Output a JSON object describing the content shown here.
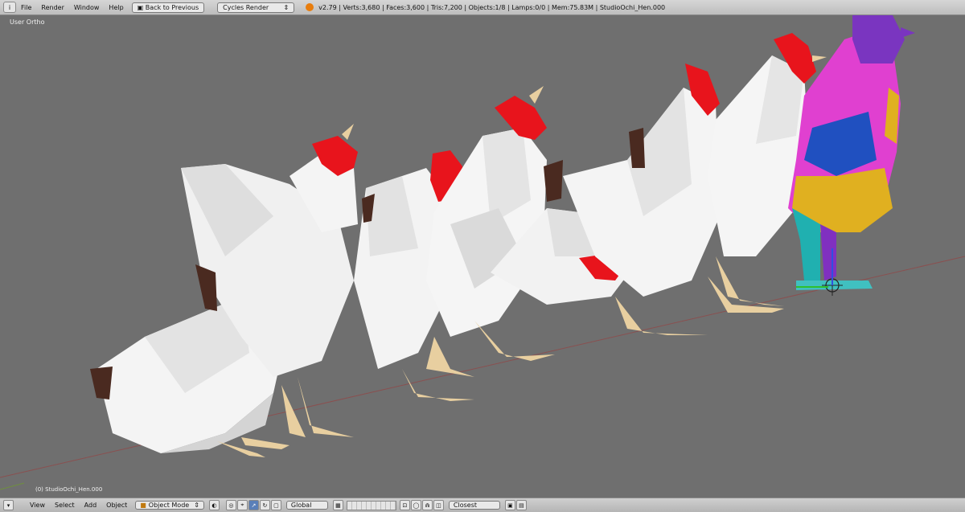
{
  "topbar": {
    "menus": [
      "File",
      "Render",
      "Window",
      "Help"
    ],
    "back_button": "Back to Previous",
    "render_engine": "Cycles Render",
    "stats": "v2.79 | Verts:3,680 | Faces:3,600 | Tris:7,200 | Objects:1/8 | Lamps:0/0 | Mem:75.83M | StudioOchi_Hen.000"
  },
  "viewport": {
    "view_name": "User Ortho",
    "active_object": "(0) StudioOchi_Hen.000"
  },
  "bottombar": {
    "menus": [
      "View",
      "Select",
      "Add",
      "Object"
    ],
    "mode": "Object Mode",
    "orientation": "Global",
    "snap_target": "Closest"
  },
  "colors": {
    "viewport_bg": "#6f6f6f",
    "header_bg": "#c4c4c4",
    "hen_body": "#f2f2f2",
    "comb": "#e8141c",
    "legs": "#e8cfa0",
    "tail": "#4a2a20"
  }
}
